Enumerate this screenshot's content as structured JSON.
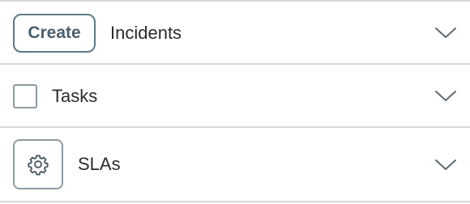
{
  "accordion": {
    "rows": [
      {
        "label": "Incidents",
        "action_label": "Create",
        "toggle_icon": "chevron-down-icon"
      },
      {
        "label": "Tasks",
        "control": "checkbox",
        "checked": false,
        "toggle_icon": "chevron-down-icon"
      },
      {
        "label": "SLAs",
        "control_icon": "gear-icon",
        "toggle_icon": "chevron-down-icon"
      }
    ]
  },
  "colors": {
    "divider": "#d9d9d9",
    "button_border": "#5d7a86",
    "button_text": "#4a606b",
    "control_border": "#8e9ba2",
    "text": "#2b2b2b",
    "chevron": "#5f6b72"
  }
}
